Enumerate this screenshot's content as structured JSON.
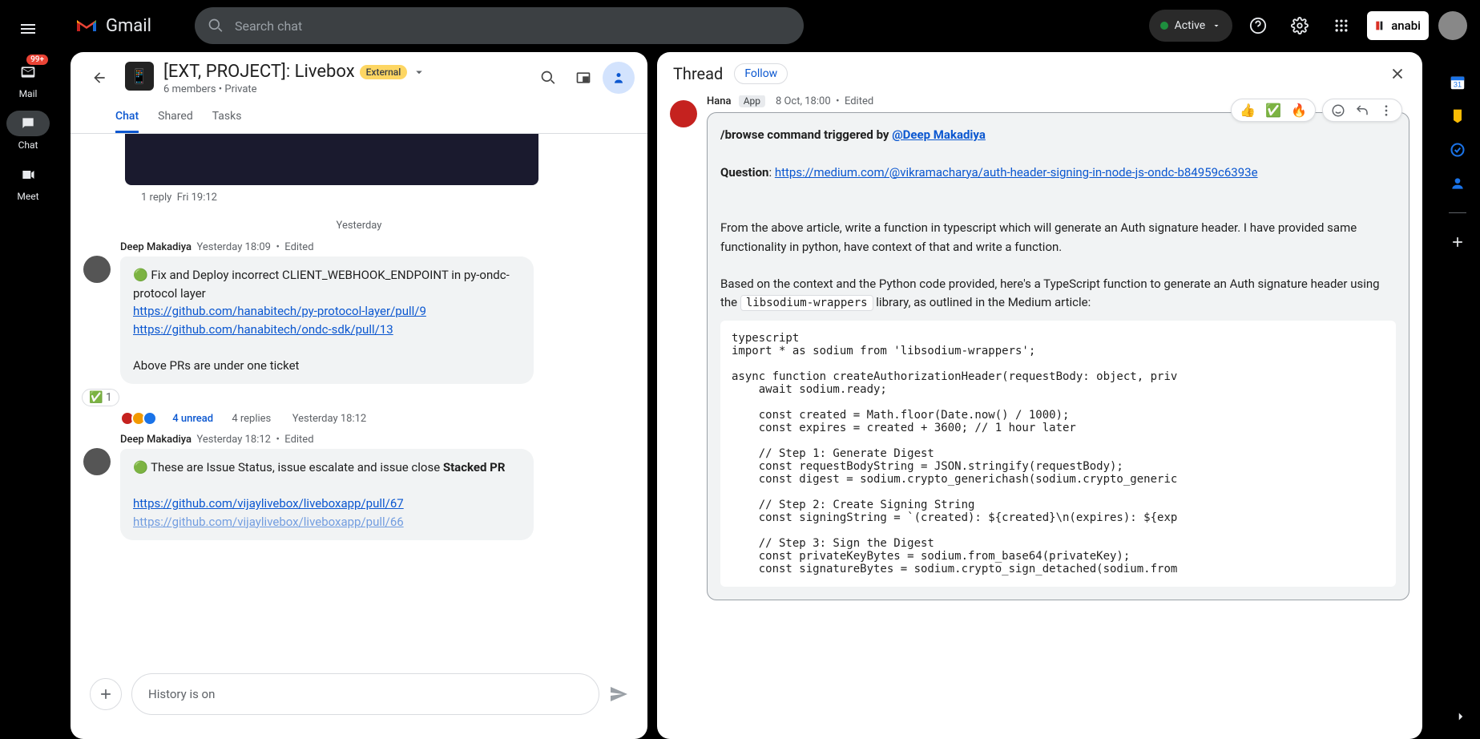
{
  "brand": "Gmail",
  "search": {
    "placeholder": "Search chat"
  },
  "presence": {
    "label": "Active"
  },
  "account": {
    "org_label": "anabi"
  },
  "left_rail": {
    "mail": {
      "label": "Mail",
      "badge": "99+"
    },
    "chat": {
      "label": "Chat"
    },
    "meet": {
      "label": "Meet"
    }
  },
  "chat_header": {
    "title": "[EXT, PROJECT]: Livebox",
    "external_badge": "External",
    "subtitle": "6 members  •  Private",
    "tabs": [
      "Chat",
      "Shared",
      "Tasks"
    ],
    "active_tab_index": 0
  },
  "chat_stream": {
    "reply_line": {
      "count": "1 reply",
      "time": "Fri 19:12"
    },
    "day_separator": "Yesterday",
    "msg1": {
      "author": "Deep Makadiya",
      "time": "Yesterday 18:09",
      "edited": "Edited",
      "line1": "🟢 Fix and Deploy incorrect CLIENT_WEBHOOK_ENDPOINT in py-ondc-protocol layer",
      "link1": "https://github.com/hanabitech/py-protocol-layer/pull/9",
      "link2": "https://github.com/hanabitech/ondc-sdk/pull/13",
      "line2": "Above PRs are under one ticket",
      "reaction": {
        "emoji": "✅",
        "count": "1"
      },
      "thread_summary": {
        "unread": "4 unread",
        "replies": "4 replies",
        "time": "Yesterday 18:12"
      }
    },
    "msg2": {
      "author": "Deep Makadiya",
      "time": "Yesterday 18:12",
      "edited": "Edited",
      "line1_prefix": "🟢 These are Issue Status, issue escalate and issue close ",
      "line1_bold": "Stacked PR",
      "link1": "https://github.com/vijaylivebox/liveboxapp/pull/67",
      "link2": "https://github.com/vijaylivebox/liveboxapp/pull/66"
    }
  },
  "compose": {
    "placeholder": "History is on"
  },
  "thread": {
    "title": "Thread",
    "follow_label": "Follow",
    "msg": {
      "author": "Hana",
      "app_chip": "App",
      "time": "8 Oct, 18:00",
      "edited": "Edited",
      "command_prefix": "/browse command triggered by ",
      "mention": "@Deep Makadiya",
      "question_label": "Question",
      "question_link": "https://medium.com/@vikramacharya/auth-header-signing-in-node-js-ondc-b84959c6393e",
      "para1": "From the above article, write a function in typescript which will generate an Auth signature header. I have provided same functionality in python, have context of that and write a function.",
      "para2_a": "Based on the context and the Python code provided, here's a TypeScript function to generate an Auth signature header using the ",
      "code_inline": "libsodium-wrappers",
      "para2_b": " library, as outlined in the Medium article:",
      "code_block": "typescript\nimport * as sodium from 'libsodium-wrappers';\n\nasync function createAuthorizationHeader(requestBody: object, priv\n    await sodium.ready;\n\n    const created = Math.floor(Date.now() / 1000);\n    const expires = created + 3600; // 1 hour later\n\n    // Step 1: Generate Digest\n    const requestBodyString = JSON.stringify(requestBody);\n    const digest = sodium.crypto_generichash(sodium.crypto_generic\n\n    // Step 2: Create Signing String\n    const signingString = `(created): ${created}\\n(expires): ${exp\n\n    // Step 3: Sign the Digest\n    const privateKeyBytes = sodium.from_base64(privateKey);\n    const signatureBytes = sodium.crypto_sign_detached(sodium.from"
    },
    "reactions": [
      "👍",
      "✅",
      "🔥"
    ]
  }
}
